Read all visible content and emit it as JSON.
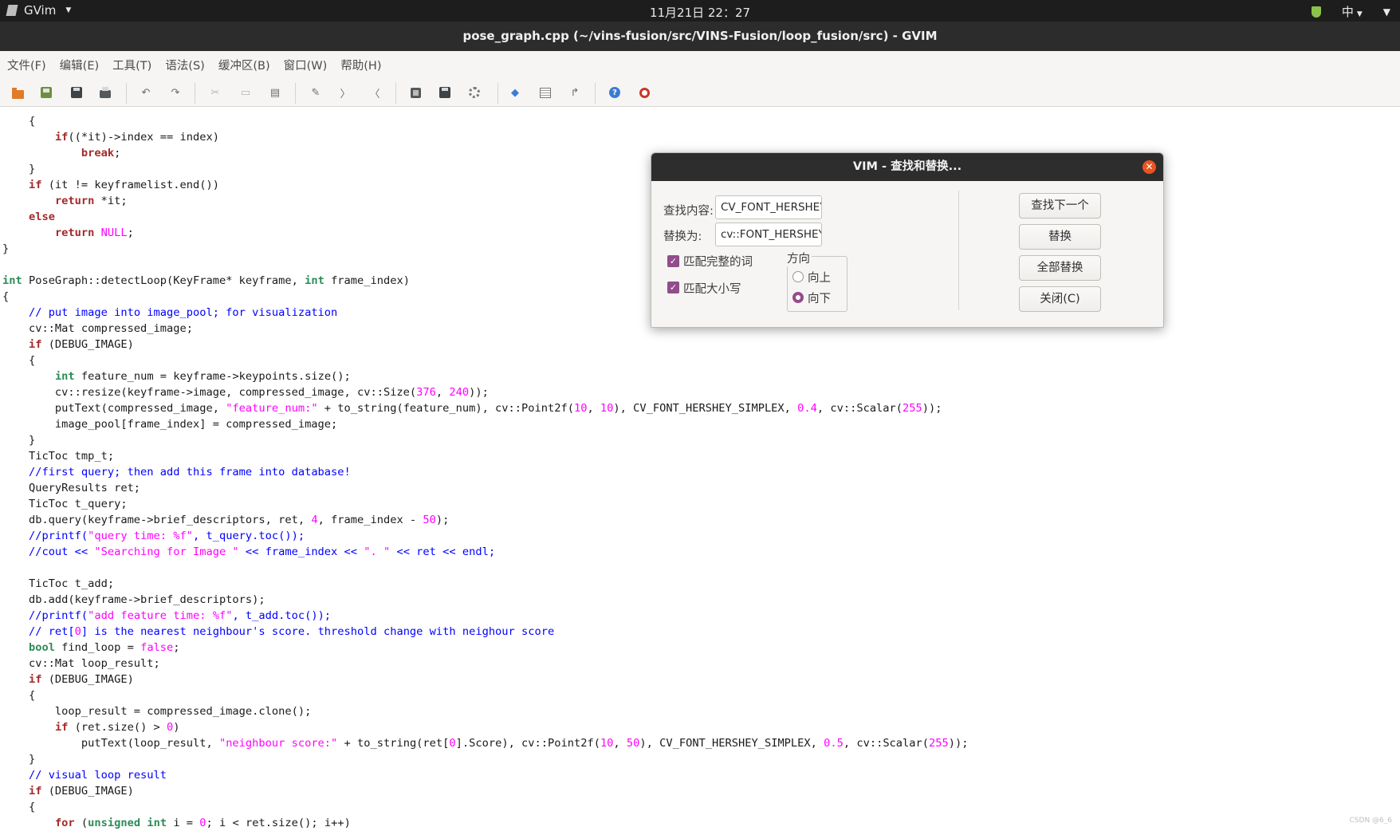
{
  "top_panel": {
    "app_name": "GVim",
    "clock": "11月21日  22：27",
    "input_method": "中"
  },
  "window": {
    "title": "pose_graph.cpp (~/vins-fusion/src/VINS-Fusion/loop_fusion/src) - GVIM"
  },
  "menu": [
    "文件(F)",
    "编辑(E)",
    "工具(T)",
    "语法(S)",
    "缓冲区(B)",
    "窗口(W)",
    "帮助(H)"
  ],
  "toolbar": {
    "icons": [
      "open-file-icon",
      "save-file-icon",
      "save-all-icon",
      "print-icon",
      "undo-icon",
      "redo-icon",
      "cut-icon",
      "copy-icon",
      "paste-icon",
      "find-replace-icon",
      "find-next-icon",
      "find-prev-icon",
      "load-session-icon",
      "save-session-icon",
      "run-script-icon",
      "make-icon",
      "shell-icon",
      "tag-jump-icon",
      "help-icon",
      "find-help-icon"
    ]
  },
  "code_lines": [
    [
      {
        "t": "    {"
      }
    ],
    [
      {
        "t": "        "
      },
      {
        "t": "if",
        "c": "kw"
      },
      {
        "t": "((*it)->index == index)"
      }
    ],
    [
      {
        "t": "            "
      },
      {
        "t": "break",
        "c": "kw"
      },
      {
        "t": ";"
      }
    ],
    [
      {
        "t": "    }"
      }
    ],
    [
      {
        "t": "    "
      },
      {
        "t": "if",
        "c": "kw"
      },
      {
        "t": " (it != keyframelist.end())"
      }
    ],
    [
      {
        "t": "        "
      },
      {
        "t": "return",
        "c": "kw"
      },
      {
        "t": " *it;"
      }
    ],
    [
      {
        "t": "    "
      },
      {
        "t": "else",
        "c": "kw"
      }
    ],
    [
      {
        "t": "        "
      },
      {
        "t": "return",
        "c": "kw"
      },
      {
        "t": " "
      },
      {
        "t": "NULL",
        "c": "nu"
      },
      {
        "t": ";"
      }
    ],
    [
      {
        "t": "}"
      }
    ],
    [
      {
        "t": ""
      }
    ],
    [
      {
        "t": "int",
        "c": "ty"
      },
      {
        "t": " PoseGraph::detectLoop(KeyFrame* keyframe, "
      },
      {
        "t": "int",
        "c": "ty"
      },
      {
        "t": " frame_index)"
      }
    ],
    [
      {
        "t": "{"
      }
    ],
    [
      {
        "t": "    "
      },
      {
        "t": "// put image into image_pool; for visualization",
        "c": "cm"
      }
    ],
    [
      {
        "t": "    cv::Mat compressed_image;"
      }
    ],
    [
      {
        "t": "    "
      },
      {
        "t": "if",
        "c": "kw"
      },
      {
        "t": " (DEBUG_IMAGE)"
      }
    ],
    [
      {
        "t": "    {"
      }
    ],
    [
      {
        "t": "        "
      },
      {
        "t": "int",
        "c": "ty"
      },
      {
        "t": " feature_num = keyframe->keypoints.size();"
      }
    ],
    [
      {
        "t": "        cv::resize(keyframe->image, compressed_image, cv::Size("
      },
      {
        "t": "376",
        "c": "nu"
      },
      {
        "t": ", "
      },
      {
        "t": "240",
        "c": "nu"
      },
      {
        "t": "));"
      }
    ],
    [
      {
        "t": "        putText(compressed_image, "
      },
      {
        "t": "\"feature_num:\"",
        "c": "st"
      },
      {
        "t": " + to_string(feature_num), cv::Point2f("
      },
      {
        "t": "10",
        "c": "nu"
      },
      {
        "t": ", "
      },
      {
        "t": "10",
        "c": "nu"
      },
      {
        "t": "), CV_FONT_HERSHEY_SIMPLEX, "
      },
      {
        "t": "0.4",
        "c": "nu"
      },
      {
        "t": ", cv::Scalar("
      },
      {
        "t": "255",
        "c": "nu"
      },
      {
        "t": "));"
      }
    ],
    [
      {
        "t": "        image_pool[frame_index] = compressed_image;"
      }
    ],
    [
      {
        "t": "    }"
      }
    ],
    [
      {
        "t": "    TicToc tmp_t;"
      }
    ],
    [
      {
        "t": "    "
      },
      {
        "t": "//first query; then add this frame into database!",
        "c": "cm"
      }
    ],
    [
      {
        "t": "    QueryResults ret;"
      }
    ],
    [
      {
        "t": "    TicToc t_query;"
      }
    ],
    [
      {
        "t": "    db.query(keyframe->brief_descriptors, ret, "
      },
      {
        "t": "4",
        "c": "nu"
      },
      {
        "t": ", frame_index - "
      },
      {
        "t": "50",
        "c": "nu"
      },
      {
        "t": ");"
      }
    ],
    [
      {
        "t": "    "
      },
      {
        "t": "//printf(",
        "c": "cm"
      },
      {
        "t": "\"query time: %f\"",
        "c": "st"
      },
      {
        "t": ", t_query.toc());",
        "c": "cm"
      }
    ],
    [
      {
        "t": "    "
      },
      {
        "t": "//cout << ",
        "c": "cm"
      },
      {
        "t": "\"Searching for Image \"",
        "c": "st"
      },
      {
        "t": " << frame_index << ",
        "c": "cm"
      },
      {
        "t": "\". \"",
        "c": "st"
      },
      {
        "t": " << ret << endl;",
        "c": "cm"
      }
    ],
    [
      {
        "t": ""
      }
    ],
    [
      {
        "t": "    TicToc t_add;"
      }
    ],
    [
      {
        "t": "    db.add(keyframe->brief_descriptors);"
      }
    ],
    [
      {
        "t": "    "
      },
      {
        "t": "//printf(",
        "c": "cm"
      },
      {
        "t": "\"add feature time: %f\"",
        "c": "st"
      },
      {
        "t": ", t_add.toc());",
        "c": "cm"
      }
    ],
    [
      {
        "t": "    "
      },
      {
        "t": "// ret[",
        "c": "cm"
      },
      {
        "t": "0",
        "c": "nu"
      },
      {
        "t": "] is the nearest neighbour's score. threshold change with neighour score",
        "c": "cm"
      }
    ],
    [
      {
        "t": "    "
      },
      {
        "t": "bool",
        "c": "ty"
      },
      {
        "t": " find_loop = "
      },
      {
        "t": "false",
        "c": "nu"
      },
      {
        "t": ";"
      }
    ],
    [
      {
        "t": "    cv::Mat loop_result;"
      }
    ],
    [
      {
        "t": "    "
      },
      {
        "t": "if",
        "c": "kw"
      },
      {
        "t": " (DEBUG_IMAGE)"
      }
    ],
    [
      {
        "t": "    {"
      }
    ],
    [
      {
        "t": "        loop_result = compressed_image.clone();"
      }
    ],
    [
      {
        "t": "        "
      },
      {
        "t": "if",
        "c": "kw"
      },
      {
        "t": " (ret.size() > "
      },
      {
        "t": "0",
        "c": "nu"
      },
      {
        "t": ")"
      }
    ],
    [
      {
        "t": "            putText(loop_result, "
      },
      {
        "t": "\"neighbour score:\"",
        "c": "st"
      },
      {
        "t": " + to_string(ret["
      },
      {
        "t": "0",
        "c": "nu"
      },
      {
        "t": "].Score), cv::Point2f("
      },
      {
        "t": "10",
        "c": "nu"
      },
      {
        "t": ", "
      },
      {
        "t": "50",
        "c": "nu"
      },
      {
        "t": "), CV_FONT_HERSHEY_SIMPLEX, "
      },
      {
        "t": "0.5",
        "c": "nu"
      },
      {
        "t": ", cv::Scalar("
      },
      {
        "t": "255",
        "c": "nu"
      },
      {
        "t": "));"
      }
    ],
    [
      {
        "t": "    }"
      }
    ],
    [
      {
        "t": "    "
      },
      {
        "t": "// visual loop result",
        "c": "cm"
      }
    ],
    [
      {
        "t": "    "
      },
      {
        "t": "if",
        "c": "kw"
      },
      {
        "t": " (DEBUG_IMAGE)"
      }
    ],
    [
      {
        "t": "    {"
      }
    ],
    [
      {
        "t": "        "
      },
      {
        "t": "for",
        "c": "kw"
      },
      {
        "t": " ("
      },
      {
        "t": "unsigned",
        "c": "ty"
      },
      {
        "t": " "
      },
      {
        "t": "int",
        "c": "ty"
      },
      {
        "t": " i = "
      },
      {
        "t": "0",
        "c": "nu"
      },
      {
        "t": "; i < ret.size(); i++)"
      }
    ]
  ],
  "dialog": {
    "title": "VIM - 查找和替换...",
    "find_label": "查找内容:",
    "find_value": "CV_FONT_HERSHEY_SIMPLEX",
    "replace_label": "替换为:",
    "replace_value": "cv::FONT_HERSHEY_SIMPLEX",
    "match_whole_word": "匹配完整的词",
    "match_case": "匹配大小写",
    "direction_label": "方向",
    "up_label": "向上",
    "down_label": "向下",
    "find_next_button": "查找下一个",
    "replace_button": "替换",
    "replace_all_button": "全部替换",
    "close_button": "关闭(C)",
    "match_whole_word_checked": true,
    "match_case_checked": true,
    "direction_selected": "向下"
  },
  "watermark": "CSDN @6_6"
}
